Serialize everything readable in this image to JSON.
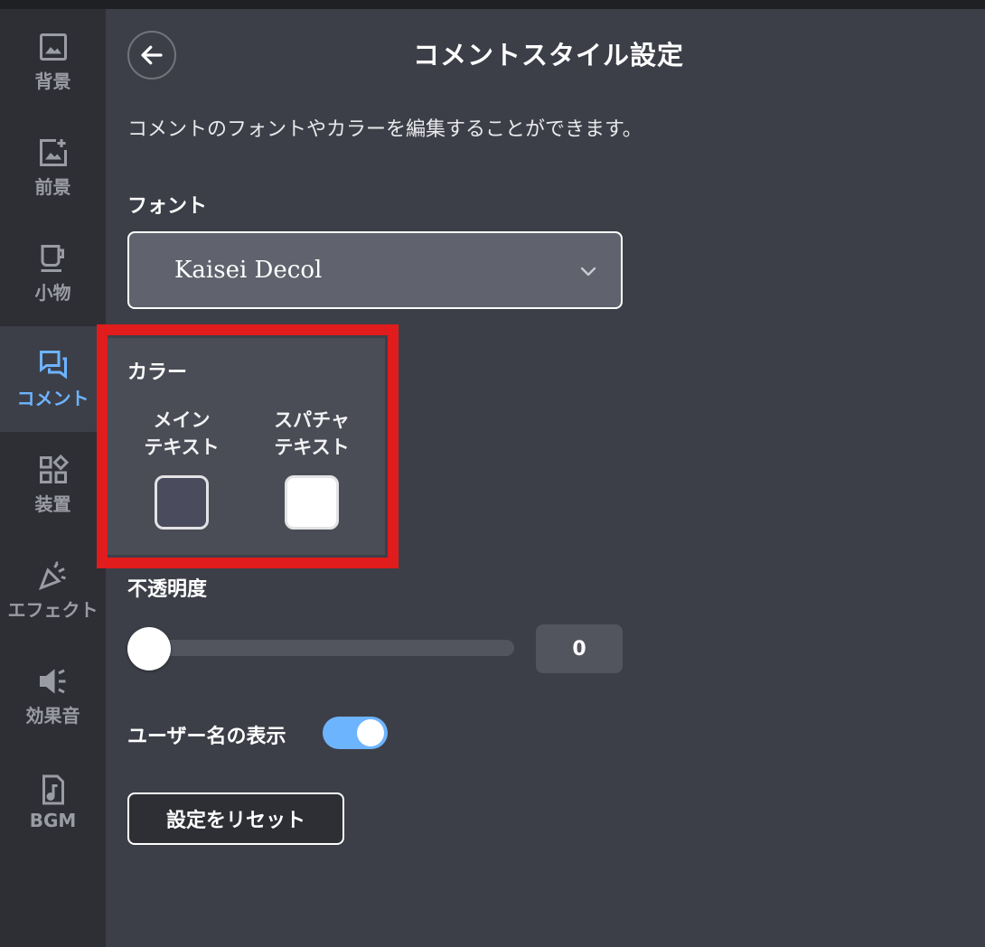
{
  "sidebar": {
    "items": [
      {
        "label": "背景",
        "icon": "image-icon",
        "active": false
      },
      {
        "label": "前景",
        "icon": "image-add-icon",
        "active": false
      },
      {
        "label": "小物",
        "icon": "cup-icon",
        "active": false
      },
      {
        "label": "コメント",
        "icon": "chat-icon",
        "active": true
      },
      {
        "label": "装置",
        "icon": "widgets-icon",
        "active": false
      },
      {
        "label": "エフェクト",
        "icon": "party-popper-icon",
        "active": false
      },
      {
        "label": "効果音",
        "icon": "speaker-icon",
        "active": false
      },
      {
        "label": "BGM",
        "icon": "music-file-icon",
        "active": false
      }
    ]
  },
  "header": {
    "title": "コメントスタイル設定",
    "back_icon": "arrow-left-icon"
  },
  "description": "コメントのフォントやカラーを編集することができます。",
  "font": {
    "label": "フォント",
    "selected": "Kaisei Decol"
  },
  "color": {
    "label": "カラー",
    "main_text": {
      "line1": "メイン",
      "line2": "テキスト",
      "value": "#4a4b5c"
    },
    "superchat_text": {
      "line1": "スパチャ",
      "line2": "テキスト",
      "value": "#ffffff"
    }
  },
  "opacity": {
    "label": "不透明度",
    "value": "0",
    "fraction": 0
  },
  "username_display": {
    "label": "ユーザー名の表示",
    "enabled": true
  },
  "reset_button": "設定をリセット",
  "colors": {
    "accent": "#6db4ff",
    "highlight": "#e01c1c",
    "background": "#3d3f48",
    "sidebar": "#2e2f35"
  }
}
